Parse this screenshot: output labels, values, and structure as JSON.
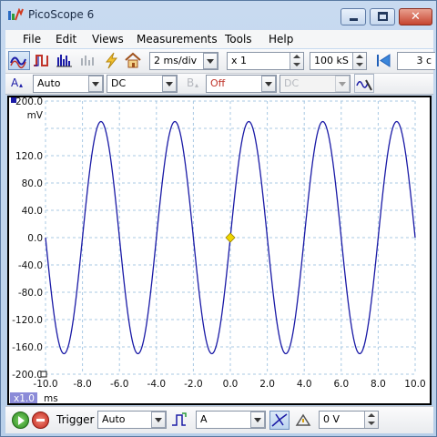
{
  "window": {
    "title": "PicoScope 6"
  },
  "menu": [
    {
      "label": "File"
    },
    {
      "label": "Edit"
    },
    {
      "label": "Views"
    },
    {
      "label": "Measurements"
    },
    {
      "label": "Tools"
    },
    {
      "label": "Help"
    }
  ],
  "toolbar": {
    "timebase": "2 ms/div",
    "zoom": "x 1",
    "samples": "100 kS",
    "captures": "3 c"
  },
  "channel_a": {
    "letter": "A",
    "range": "Auto",
    "coupling": "DC"
  },
  "channel_b": {
    "letter": "B",
    "range": "Off",
    "coupling": "DC"
  },
  "bottom": {
    "trigger_label": "Trigger",
    "trigger_mode": "Auto",
    "trigger_channel": "A",
    "trigger_level": "0 V"
  },
  "chart_data": {
    "type": "line",
    "ylabel": "mV",
    "xlabel": "ms",
    "x_scale_tag": "x1.0",
    "xlim": [
      -10,
      10
    ],
    "ylim": [
      -200,
      200
    ],
    "x_ticks": [
      "-10.0",
      "-8.0",
      "-6.0",
      "-4.0",
      "-2.0",
      "0.0",
      "2.0",
      "4.0",
      "6.0",
      "8.0",
      "10.0"
    ],
    "y_ticks": [
      "200.0",
      "160.0",
      "120.0",
      "80.0",
      "40.0",
      "0.0",
      "-40.0",
      "-80.0",
      "-120.0",
      "-160.0",
      "-200.0"
    ],
    "y_tick_labels_shown": [
      "200.0",
      "120.0",
      "80.0",
      "40.0",
      "0.0",
      "-40.0",
      "-80.0",
      "-120.0",
      "-160.0",
      "-200.0"
    ],
    "grid": true,
    "series": [
      {
        "color": "#1a1aa6",
        "waveform": "sine",
        "amplitude": 170,
        "frequency_khz": 0.25,
        "peak_times": [
          -7.0,
          -3.0,
          1.0,
          5.0,
          9.0
        ],
        "trough_times": [
          -9.0,
          -5.0,
          -1.0,
          3.0,
          7.0
        ],
        "x_end": 10.0
      }
    ],
    "trigger_marker": {
      "x": 0.0,
      "y": 0.0,
      "color": "#f0d600"
    }
  },
  "colors": {
    "trace": "#1a1aa6",
    "grid": "#a9c9e3",
    "trigger_marker": "#f0d600",
    "scale_tag_bg": "#8b8bd8"
  }
}
